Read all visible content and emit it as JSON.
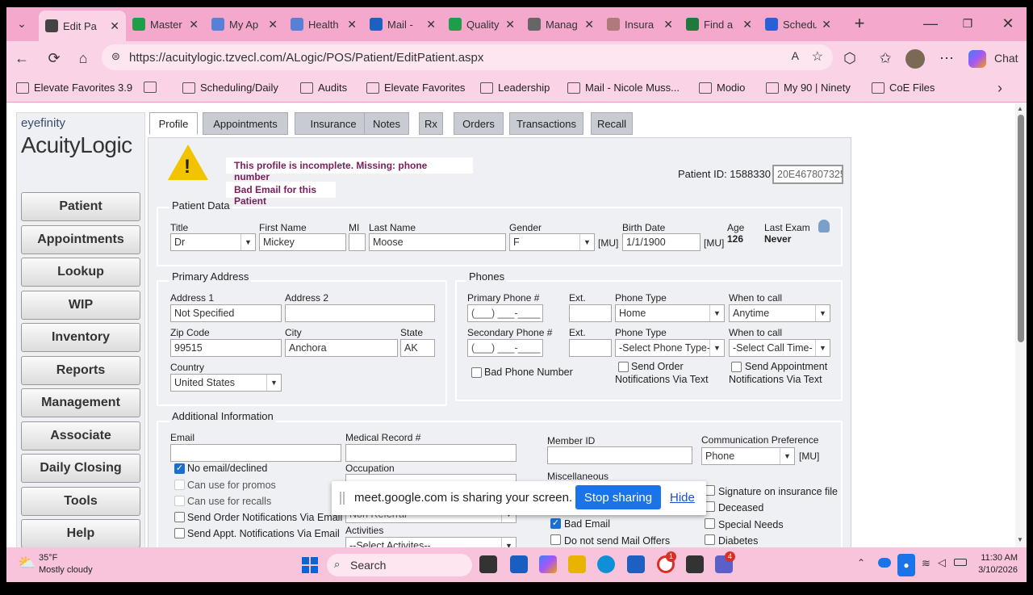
{
  "browser": {
    "tabs": [
      {
        "title": "Edit Pa",
        "icon": "pin-icon",
        "color": "#444"
      },
      {
        "title": "Master",
        "icon": "sheets-icon",
        "color": "#1e9e4a"
      },
      {
        "title": "My Ap",
        "icon": "snowflake-icon",
        "color": "#5a7fd6"
      },
      {
        "title": "Health",
        "icon": "snowflake-icon",
        "color": "#5a7fd6"
      },
      {
        "title": "Mail - ",
        "icon": "outlook-icon",
        "color": "#1f5fbf"
      },
      {
        "title": "Quality",
        "icon": "sheets-icon",
        "color": "#1e9e4a"
      },
      {
        "title": "Manag",
        "icon": "headset-icon",
        "color": "#666"
      },
      {
        "title": "Insura",
        "icon": "doc-icon",
        "color": "#b07a7a"
      },
      {
        "title": "Find a",
        "icon": "sheets-icon",
        "color": "#1e7a3a"
      },
      {
        "title": "Schedu",
        "icon": "word-icon",
        "color": "#2b5fd6"
      }
    ],
    "url": "https://acuitylogic.tzvecl.com/ALogic/POS/Patient/EditPatient.aspx",
    "chat_label": "Chat",
    "favorites": [
      {
        "label": "Elevate Favorites 3.9",
        "icon": "bookmark-icon"
      },
      {
        "label": "",
        "icon": "link-icon"
      },
      {
        "label": "Scheduling/Daily",
        "icon": "folder-icon"
      },
      {
        "label": "Audits",
        "icon": "folder-icon"
      },
      {
        "label": "Elevate Favorites",
        "icon": "folder-icon"
      },
      {
        "label": "Leadership",
        "icon": "folder-icon"
      },
      {
        "label": "Mail - Nicole Muss...",
        "icon": "outlook-icon"
      },
      {
        "label": "Modio",
        "icon": "snowflake-icon"
      },
      {
        "label": "My 90 | Ninety",
        "icon": "ninety-icon"
      },
      {
        "label": "CoE Files",
        "icon": "sharepoint-icon"
      }
    ]
  },
  "app": {
    "logo_small": "eyefinity",
    "logo_big": "AcuityLogic",
    "nav": [
      "Patient",
      "Appointments",
      "Lookup",
      "WIP",
      "Inventory",
      "Reports",
      "Management",
      "Associate",
      "Daily Closing",
      "Tools",
      "Help"
    ],
    "tabs": [
      "Profile",
      "Appointments",
      "Insurance",
      "Notes",
      "Rx",
      "Orders",
      "Transactions",
      "Recall"
    ],
    "warning_incomplete": "This profile is incomplete. Missing: phone number",
    "warning_email": "Bad Email for this Patient",
    "patient_id_label": "Patient ID: 1588330",
    "patient_code": "20E467807325",
    "patient_data": {
      "section": "Patient Data",
      "title_label": "Title",
      "title": "Dr",
      "first_label": "First Name",
      "first": "Mickey",
      "mi_label": "MI",
      "mi": "",
      "last_label": "Last Name",
      "last": "Moose",
      "gender_label": "Gender",
      "gender": "F",
      "mu": "[MU]",
      "birth_label": "Birth Date",
      "birth": "1/1/1900",
      "age_label": "Age",
      "age": "126",
      "exam_label": "Last Exam",
      "exam": "Never"
    },
    "address": {
      "section": "Primary Address",
      "addr1_label": "Address 1",
      "addr1": "Not Specified",
      "addr2_label": "Address 2",
      "addr2": "",
      "zip_label": "Zip Code",
      "zip": "99515",
      "city_label": "City",
      "city": "Anchora",
      "state_label": "State",
      "state": "AK",
      "country_label": "Country",
      "country": "United States"
    },
    "phones": {
      "section": "Phones",
      "primary_label": "Primary Phone #",
      "primary": "(___) ___-____",
      "ext_label": "Ext.",
      "type_label": "Phone Type",
      "type1": "Home",
      "when_label": "When to call",
      "when1": "Anytime",
      "secondary_label": "Secondary Phone #",
      "secondary": "(___) ___-____",
      "type2": "-Select Phone Type-",
      "when2": "-Select Call Time-",
      "bad_phone": "Bad Phone Number",
      "send_order": "Send Order",
      "send_order_2": "Notifications Via Text",
      "send_appt": "Send Appointment",
      "send_appt_2": "Notifications Via Text"
    },
    "additional": {
      "section": "Additional Information",
      "email_label": "Email",
      "email": "",
      "medrec_label": "Medical Record #",
      "medrec": "",
      "member_label": "Member ID",
      "member": "",
      "comm_label": "Communication Preference",
      "comm": "Phone",
      "mu": "[MU]",
      "no_email": "No email/declined",
      "promos": "Can use for promos",
      "recalls": "Can use for recalls",
      "order_email": "Send Order Notifications Via Email",
      "appt_email": "Send Appt. Notifications Via Email",
      "occupation_label": "Occupation",
      "referral": "Non Referral",
      "activities_label": "Activities",
      "activities": "--Select Activites--",
      "misc_label": "Miscellaneous",
      "bad_email": "Bad Email",
      "no_mail": "Do not send Mail Offers",
      "signature": "Signature on insurance file",
      "deceased": "Deceased",
      "special": "Special Needs",
      "diabetes": "Diabetes"
    }
  },
  "share_banner": {
    "text": "meet.google.com is sharing your screen.",
    "stop": "Stop sharing",
    "hide": "Hide"
  },
  "taskbar": {
    "temp": "35°F",
    "weather": "Mostly cloudy",
    "search": "Search",
    "time": "11:30 AM",
    "date": "3/10/2026",
    "badge1": "1",
    "badge2": "4"
  }
}
